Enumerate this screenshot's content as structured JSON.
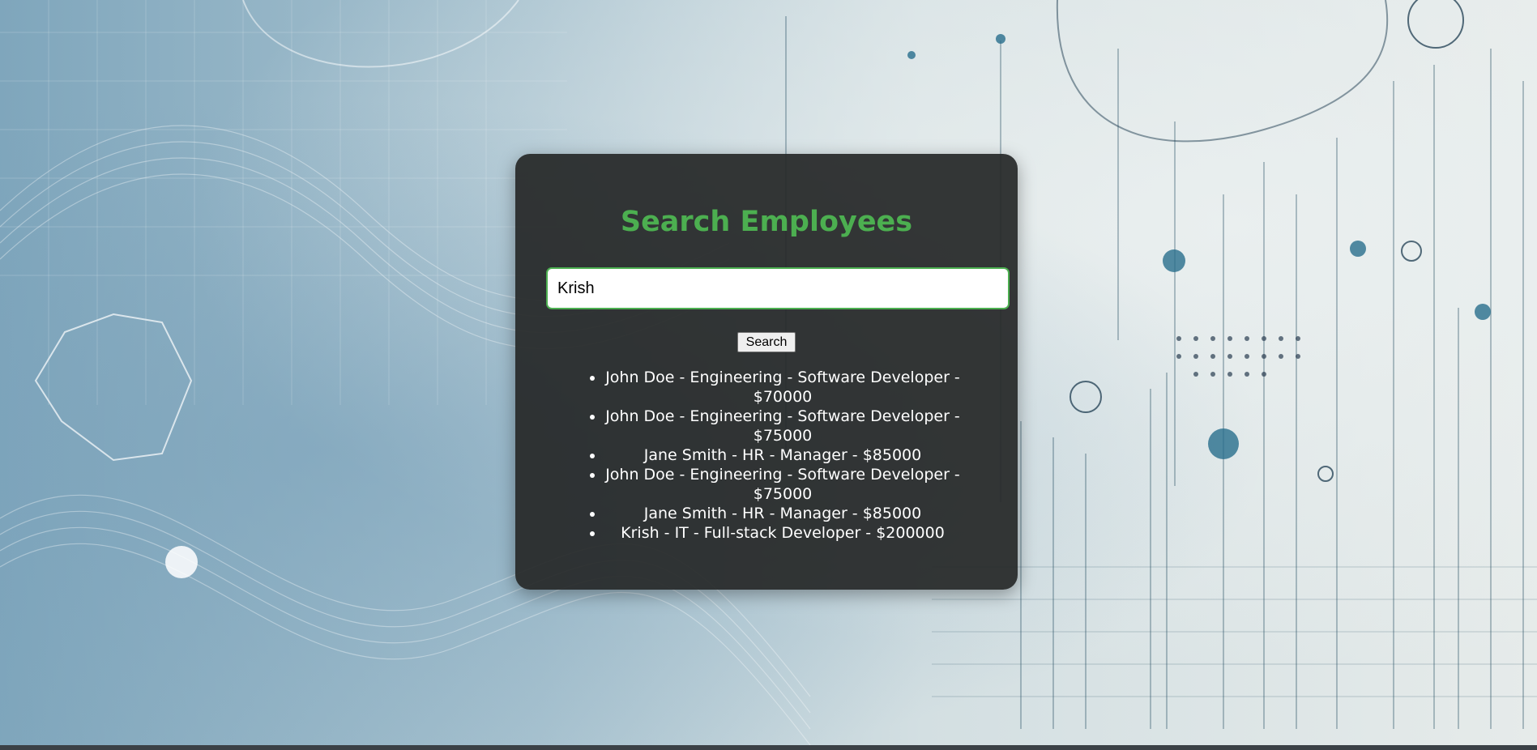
{
  "page": {
    "title": "Search Employees"
  },
  "search": {
    "value": "Krish",
    "placeholder": "",
    "button_label": "Search"
  },
  "results": [
    "John Doe - Engineering - Software Developer - $70000",
    "John Doe - Engineering - Software Developer - $75000",
    "Jane Smith - HR - Manager - $85000",
    "John Doe - Engineering - Software Developer - $75000",
    "Jane Smith - HR - Manager - $85000",
    "Krish - IT - Full-stack Developer - $200000"
  ],
  "colors": {
    "accent": "#4caf50",
    "card_background": "#262828",
    "text": "#ffffff"
  }
}
